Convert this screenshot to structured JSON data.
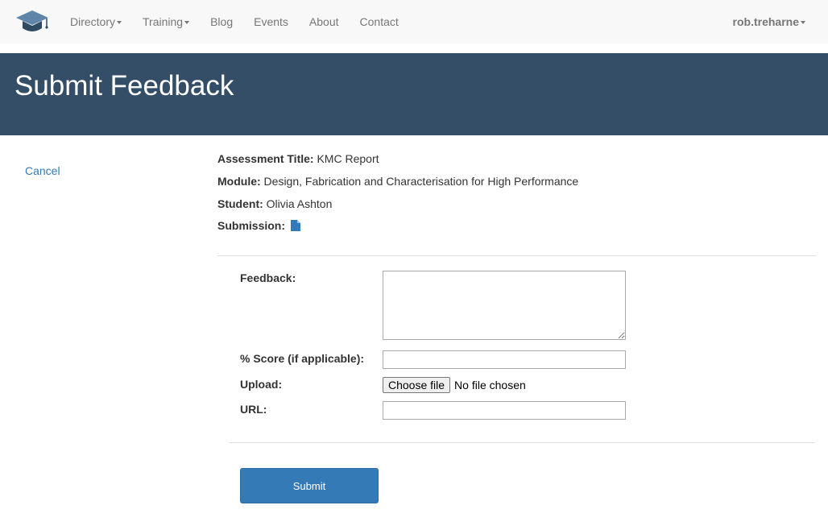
{
  "navbar": {
    "logo_icon": "graduation-cap-icon",
    "items": [
      {
        "label": "Directory",
        "dropdown": true
      },
      {
        "label": "Training",
        "dropdown": true
      },
      {
        "label": "Blog",
        "dropdown": false
      },
      {
        "label": "Events",
        "dropdown": false
      },
      {
        "label": "About",
        "dropdown": false
      },
      {
        "label": "Contact",
        "dropdown": false
      }
    ],
    "user": "rob.treharne"
  },
  "header": {
    "title": "Submit Feedback"
  },
  "sidebar": {
    "cancel_label": "Cancel"
  },
  "details": {
    "assessment_title_label": "Assessment Title:",
    "assessment_title_value": "KMC Report",
    "module_label": "Module:",
    "module_value": "Design, Fabrication and Characterisation for High Performance",
    "student_label": "Student:",
    "student_value": "Olivia Ashton",
    "submission_label": "Submission:",
    "submission_icon": "file-icon"
  },
  "form": {
    "feedback_label": "Feedback:",
    "feedback_value": "",
    "score_label": "% Score (if applicable):",
    "score_value": "",
    "upload_label": "Upload:",
    "upload_button_label": "Choose file",
    "upload_status": "No file chosen",
    "url_label": "URL:",
    "url_value": "",
    "submit_label": "Submit"
  },
  "colors": {
    "header_bg": "#334e66",
    "navbar_bg": "#f8f8f8",
    "link": "#337ab7",
    "primary_button": "#337ab7",
    "logo": "#5f86a8"
  }
}
